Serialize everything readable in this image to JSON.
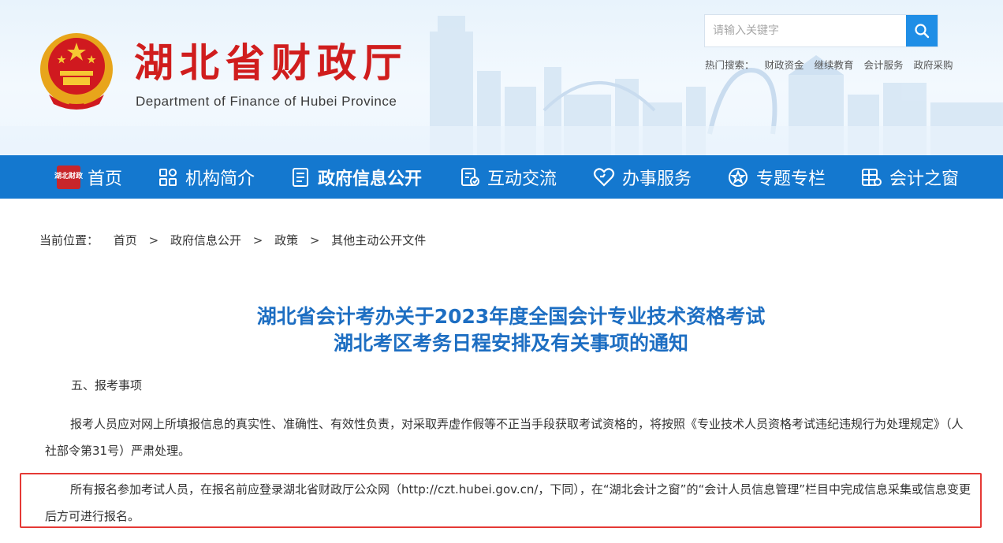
{
  "header": {
    "site_title": "湖北省财政厅",
    "site_subtitle": "Department of Finance of Hubei Province",
    "search_placeholder": "请输入关键字",
    "hot_search_label": "热门搜索：",
    "hot_search_links": [
      "财政资金",
      "继续教育",
      "会计服务",
      "政府采购"
    ]
  },
  "nav": {
    "items": [
      {
        "label": "首页",
        "icon": "home-badge-icon",
        "badge_text": "湖北财政"
      },
      {
        "label": "机构简介",
        "icon": "grid-icon"
      },
      {
        "label": "政府信息公开",
        "icon": "document-list-icon"
      },
      {
        "label": "互动交流",
        "icon": "form-chat-icon"
      },
      {
        "label": "办事服务",
        "icon": "heart-icon"
      },
      {
        "label": "专题专栏",
        "icon": "star-circle-icon"
      },
      {
        "label": "会计之窗",
        "icon": "window-grid-icon"
      }
    ],
    "active_index": 2,
    "bar_color": "#1478cf"
  },
  "breadcrumb": {
    "label": "当前位置：",
    "items": [
      "首页",
      "政府信息公开",
      "政策",
      "其他主动公开文件"
    ],
    "separator": ">"
  },
  "article": {
    "title_line1": "湖北省会计考办关于2023年度全国会计专业技术资格考试",
    "title_line2": "湖北考区考务日程安排及有关事项的通知",
    "section_heading": "五、报考事项",
    "paragraph1": "报考人员应对网上所填报信息的真实性、准确性、有效性负责，对采取弄虚作假等不正当手段获取考试资格的，将按照《专业技术人员资格考试违纪违规行为处理规定》（人社部令第31号）严肃处理。",
    "paragraph2": "所有报名参加考试人员，在报名前应登录湖北省财政厅公众网（http://czt.hubei.gov.cn/，下同），在“湖北会计之窗”的“会计人员信息管理”栏目中完成信息采集或信息变更后方可进行报名。",
    "title_color": "#1d6ec2",
    "highlight_color": "#e53935"
  }
}
